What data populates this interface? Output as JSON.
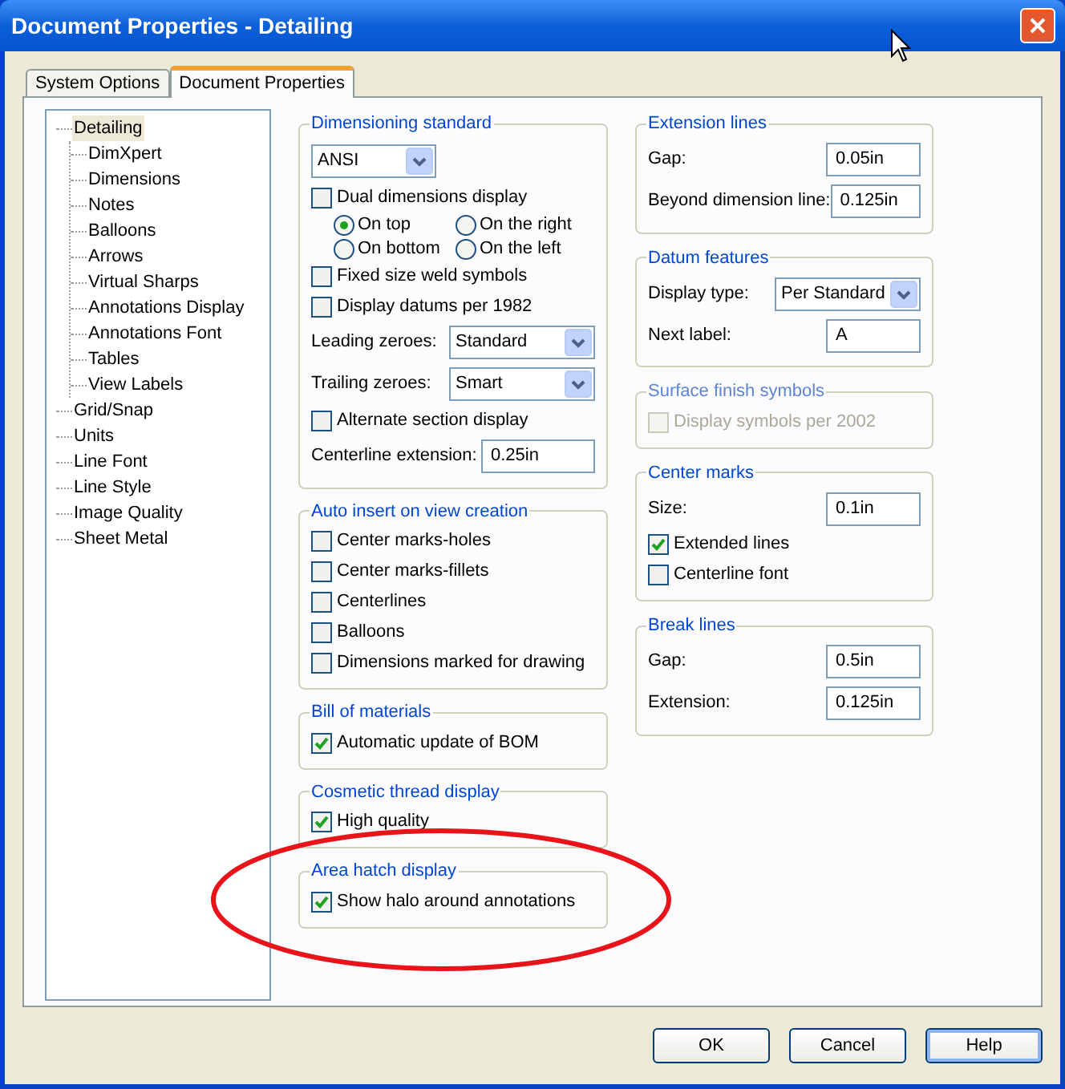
{
  "window": {
    "title": "Document Properties - Detailing"
  },
  "tabs": [
    {
      "label": "System Options",
      "selected": false
    },
    {
      "label": "Document Properties",
      "selected": true
    }
  ],
  "tree": [
    {
      "label": "Detailing",
      "selected": true,
      "children": [
        {
          "label": "DimXpert",
          "selected": false
        },
        {
          "label": "Dimensions",
          "selected": false
        },
        {
          "label": "Notes",
          "selected": false
        },
        {
          "label": "Balloons",
          "selected": false
        },
        {
          "label": "Arrows",
          "selected": false
        },
        {
          "label": "Virtual Sharps",
          "selected": false
        },
        {
          "label": "Annotations Display",
          "selected": false
        },
        {
          "label": "Annotations Font",
          "selected": false
        },
        {
          "label": "Tables",
          "selected": false
        },
        {
          "label": "View Labels",
          "selected": false
        }
      ]
    },
    {
      "label": "Grid/Snap",
      "selected": false
    },
    {
      "label": "Units",
      "selected": false
    },
    {
      "label": "Line Font",
      "selected": false
    },
    {
      "label": "Line Style",
      "selected": false
    },
    {
      "label": "Image Quality",
      "selected": false
    },
    {
      "label": "Sheet Metal",
      "selected": false
    }
  ],
  "left_groups": [
    {
      "title": "Dimensioning standard",
      "disabled": false,
      "items": [
        {
          "kind": "select",
          "value": "ANSI"
        },
        {
          "kind": "checkbox",
          "label": "Dual dimensions display",
          "checked": false
        },
        {
          "kind": "radios",
          "options": [
            {
              "label": "On top",
              "selected": true
            },
            {
              "label": "On the right",
              "selected": false
            },
            {
              "label": "On bottom",
              "selected": false
            },
            {
              "label": "On the left",
              "selected": false
            }
          ]
        },
        {
          "kind": "checkbox",
          "label": "Fixed size weld symbols",
          "checked": false
        },
        {
          "kind": "checkbox",
          "label": "Display datums per 1982",
          "checked": false
        },
        {
          "kind": "labeled_select",
          "label": "Leading zeroes:",
          "value": "Standard"
        },
        {
          "kind": "labeled_select",
          "label": "Trailing zeroes:",
          "value": "Smart"
        },
        {
          "kind": "checkbox",
          "label": "Alternate section display",
          "checked": false
        },
        {
          "kind": "field",
          "label": "Centerline extension:",
          "value": "0.25in"
        }
      ]
    },
    {
      "title": "Auto insert on view creation",
      "disabled": false,
      "items": [
        {
          "kind": "checkbox",
          "label": "Center marks-holes",
          "checked": false
        },
        {
          "kind": "checkbox",
          "label": "Center marks-fillets",
          "checked": false
        },
        {
          "kind": "checkbox",
          "label": "Centerlines",
          "checked": false
        },
        {
          "kind": "checkbox",
          "label": "Balloons",
          "checked": false
        },
        {
          "kind": "checkbox",
          "label": "Dimensions marked for drawing",
          "checked": false
        }
      ]
    },
    {
      "title": "Bill of materials",
      "disabled": false,
      "items": [
        {
          "kind": "checkbox",
          "label": "Automatic update of BOM",
          "checked": true
        }
      ]
    },
    {
      "title": "Cosmetic thread display",
      "disabled": false,
      "items": [
        {
          "kind": "checkbox",
          "label": "High quality",
          "checked": true
        }
      ]
    },
    {
      "title": "Area hatch display",
      "disabled": false,
      "items": [
        {
          "kind": "checkbox",
          "label": "Show halo around annotations",
          "checked": true
        }
      ]
    }
  ],
  "right_groups": [
    {
      "title": "Extension lines",
      "disabled": false,
      "items": [
        {
          "kind": "field",
          "label": "Gap:",
          "value": "0.05in"
        },
        {
          "kind": "field",
          "label": "Beyond dimension line:",
          "value": "0.125in"
        }
      ]
    },
    {
      "title": "Datum features",
      "disabled": false,
      "items": [
        {
          "kind": "labeled_select",
          "label": "Display type:",
          "value": "Per Standard"
        },
        {
          "kind": "field",
          "label": "Next label:",
          "value": "A"
        }
      ]
    },
    {
      "title": "Surface finish symbols",
      "disabled": true,
      "items": [
        {
          "kind": "checkbox",
          "label": "Display symbols per 2002",
          "checked": false
        }
      ]
    },
    {
      "title": "Center marks",
      "disabled": false,
      "items": [
        {
          "kind": "field",
          "label": "Size:",
          "value": "0.1in"
        },
        {
          "kind": "checkbox",
          "label": "Extended lines",
          "checked": true
        },
        {
          "kind": "checkbox",
          "label": "Centerline font",
          "checked": false
        }
      ]
    },
    {
      "title": "Break lines",
      "disabled": false,
      "items": [
        {
          "kind": "field",
          "label": "Gap:",
          "value": "0.5in"
        },
        {
          "kind": "field",
          "label": "Extension:",
          "value": "0.125in"
        }
      ]
    }
  ],
  "buttons": [
    {
      "label": "OK",
      "focused": false
    },
    {
      "label": "Cancel",
      "focused": false
    },
    {
      "label": "Help",
      "focused": true
    }
  ]
}
